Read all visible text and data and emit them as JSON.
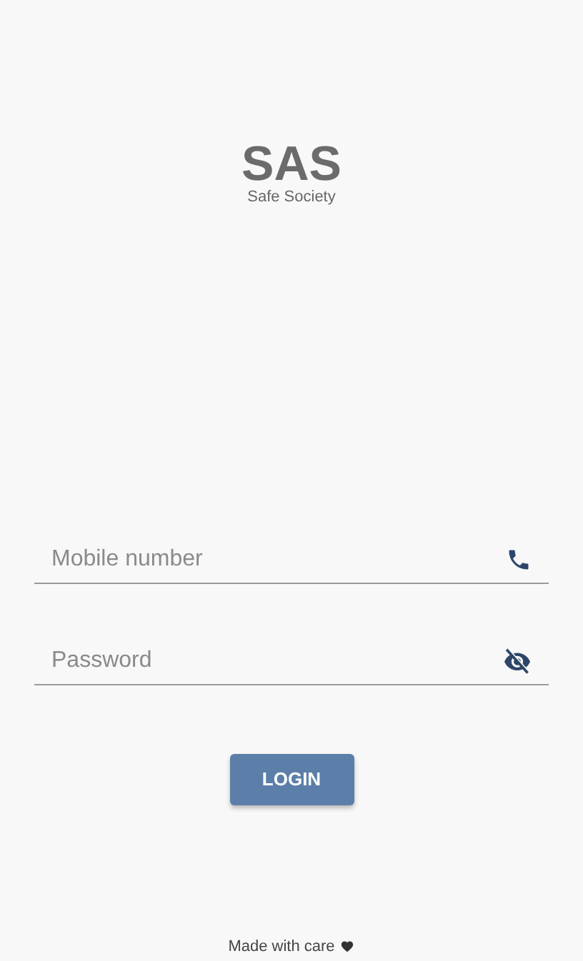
{
  "logo": {
    "title": "SAS",
    "subtitle": "Safe Society"
  },
  "fields": [
    {
      "placeholder": "Mobile number",
      "kind": "phone"
    },
    {
      "placeholder": "Password",
      "kind": "password"
    }
  ],
  "login_button": "LOGIN",
  "footer": "Made with care"
}
